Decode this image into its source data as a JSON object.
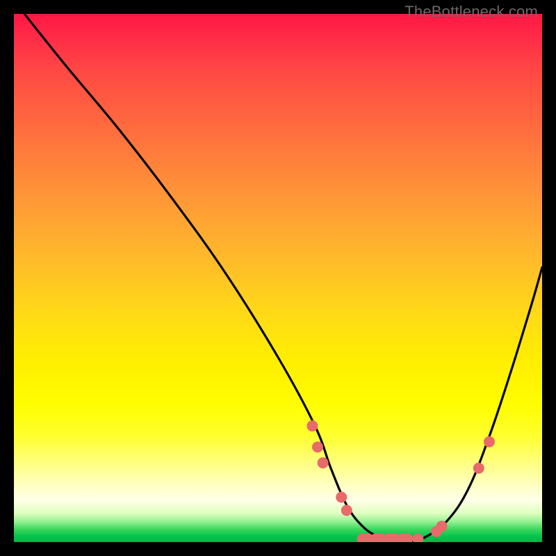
{
  "watermark": "TheBottleneck.com",
  "chart_data": {
    "type": "line",
    "title": "",
    "xlabel": "",
    "ylabel": "",
    "xlim": [
      0,
      100
    ],
    "ylim": [
      0,
      100
    ],
    "grid": false,
    "legend": "none",
    "series": [
      {
        "name": "bottleneck-curve",
        "color": "#000000",
        "x": [
          2,
          10,
          20,
          30,
          40,
          50,
          57,
          60,
          63,
          66,
          69,
          72,
          75,
          78,
          82,
          86,
          90,
          94,
          98,
          100
        ],
        "values": [
          100,
          90,
          78,
          65,
          51,
          35,
          22,
          14,
          7,
          3,
          1,
          0,
          0,
          1,
          4,
          10,
          20,
          32,
          45,
          52
        ]
      }
    ],
    "markers": [
      {
        "name": "dot",
        "x": 56.5,
        "y": 22,
        "color": "#e86a6a"
      },
      {
        "name": "dot",
        "x": 57.5,
        "y": 18,
        "color": "#e86a6a"
      },
      {
        "name": "dot",
        "x": 58.5,
        "y": 15,
        "color": "#e86a6a"
      },
      {
        "name": "dot",
        "x": 62,
        "y": 8.5,
        "color": "#e86a6a"
      },
      {
        "name": "dot",
        "x": 63,
        "y": 6,
        "color": "#e86a6a"
      },
      {
        "name": "dot",
        "x": 66,
        "y": 0.6,
        "color": "#e86a6a"
      },
      {
        "name": "dot",
        "x": 67,
        "y": 0.6,
        "color": "#e86a6a"
      },
      {
        "name": "dot",
        "x": 68.5,
        "y": 0.6,
        "color": "#e86a6a"
      },
      {
        "name": "dot",
        "x": 69.5,
        "y": 0.6,
        "color": "#e86a6a"
      },
      {
        "name": "dot",
        "x": 71,
        "y": 0.6,
        "color": "#e86a6a"
      },
      {
        "name": "dot",
        "x": 72,
        "y": 0.6,
        "color": "#e86a6a"
      },
      {
        "name": "dot",
        "x": 73.5,
        "y": 0.6,
        "color": "#e86a6a"
      },
      {
        "name": "dot",
        "x": 74.5,
        "y": 0.6,
        "color": "#e86a6a"
      },
      {
        "name": "dot",
        "x": 76.5,
        "y": 0.6,
        "color": "#e86a6a"
      },
      {
        "name": "dot",
        "x": 80,
        "y": 2,
        "color": "#e86a6a"
      },
      {
        "name": "dot",
        "x": 81,
        "y": 3,
        "color": "#e86a6a"
      },
      {
        "name": "dot",
        "x": 88,
        "y": 14,
        "color": "#e86a6a"
      },
      {
        "name": "dot",
        "x": 90,
        "y": 19,
        "color": "#e86a6a"
      }
    ],
    "background_gradient": {
      "direction": "vertical",
      "stops": [
        {
          "pos": 0,
          "color": "#ff1744"
        },
        {
          "pos": 50,
          "color": "#ffc524"
        },
        {
          "pos": 80,
          "color": "#ffff30"
        },
        {
          "pos": 96,
          "color": "#90f090"
        },
        {
          "pos": 100,
          "color": "#00b844"
        }
      ]
    }
  }
}
